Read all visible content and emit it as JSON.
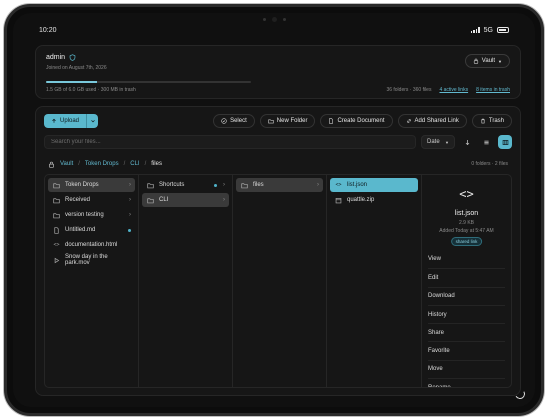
{
  "status_bar": {
    "time": "10:20",
    "network": "5G",
    "battery_level": 0.7
  },
  "account": {
    "name": "admin",
    "joined": "Joined on August 7th, 2026",
    "vault_label": "Vault",
    "usage_text": "1.5 GB of 6.0 GB used · 300 MB in trash",
    "usage_fraction": 0.25,
    "folders_files": "36 folders · 360 files",
    "active_links": "4 active links",
    "trash_items": "8 items in trash"
  },
  "toolbar": {
    "upload_label": "Upload",
    "select_label": "Select",
    "new_folder_label": "New Folder",
    "create_document_label": "Create Document",
    "add_shared_link_label": "Add Shared Link",
    "trash_label": "Trash"
  },
  "search": {
    "placeholder": "Search your files...",
    "sort_label": "Date"
  },
  "breadcrumb": {
    "items": [
      "Vault",
      "Token Drops",
      "CLI",
      "files"
    ],
    "counts": "0 folders · 2 files"
  },
  "columns": {
    "col1": [
      {
        "label": "Token Drops",
        "icon": "folder-icon"
      },
      {
        "label": "Received",
        "icon": "folder-icon"
      },
      {
        "label": "version testing",
        "icon": "folder-icon"
      },
      {
        "label": "Untitled.md",
        "icon": "document-icon"
      },
      {
        "label": "documentation.html",
        "icon": "code-icon"
      },
      {
        "label": "Snow day in the park.mov",
        "icon": "video-icon"
      }
    ],
    "col2": [
      {
        "label": "Shortcuts",
        "icon": "folder-icon"
      },
      {
        "label": "CLI",
        "icon": "folder-icon"
      }
    ],
    "col3": [
      {
        "label": "files",
        "icon": "folder-icon"
      }
    ],
    "col4": [
      {
        "label": "list.json",
        "icon": "code-icon"
      },
      {
        "label": "quattle.zip",
        "icon": "archive-icon"
      }
    ]
  },
  "detail": {
    "icon": "code-icon",
    "name": "list.json",
    "size": "2.9 KB",
    "added": "Added Today at 5:47 AM",
    "badge": "shared link",
    "actions": [
      "View",
      "Edit",
      "Download",
      "History",
      "Share",
      "Favorite",
      "Move",
      "Rename"
    ]
  },
  "colors": {
    "accent": "#5ab8cd",
    "background": "#101010",
    "panel": "#161616"
  }
}
